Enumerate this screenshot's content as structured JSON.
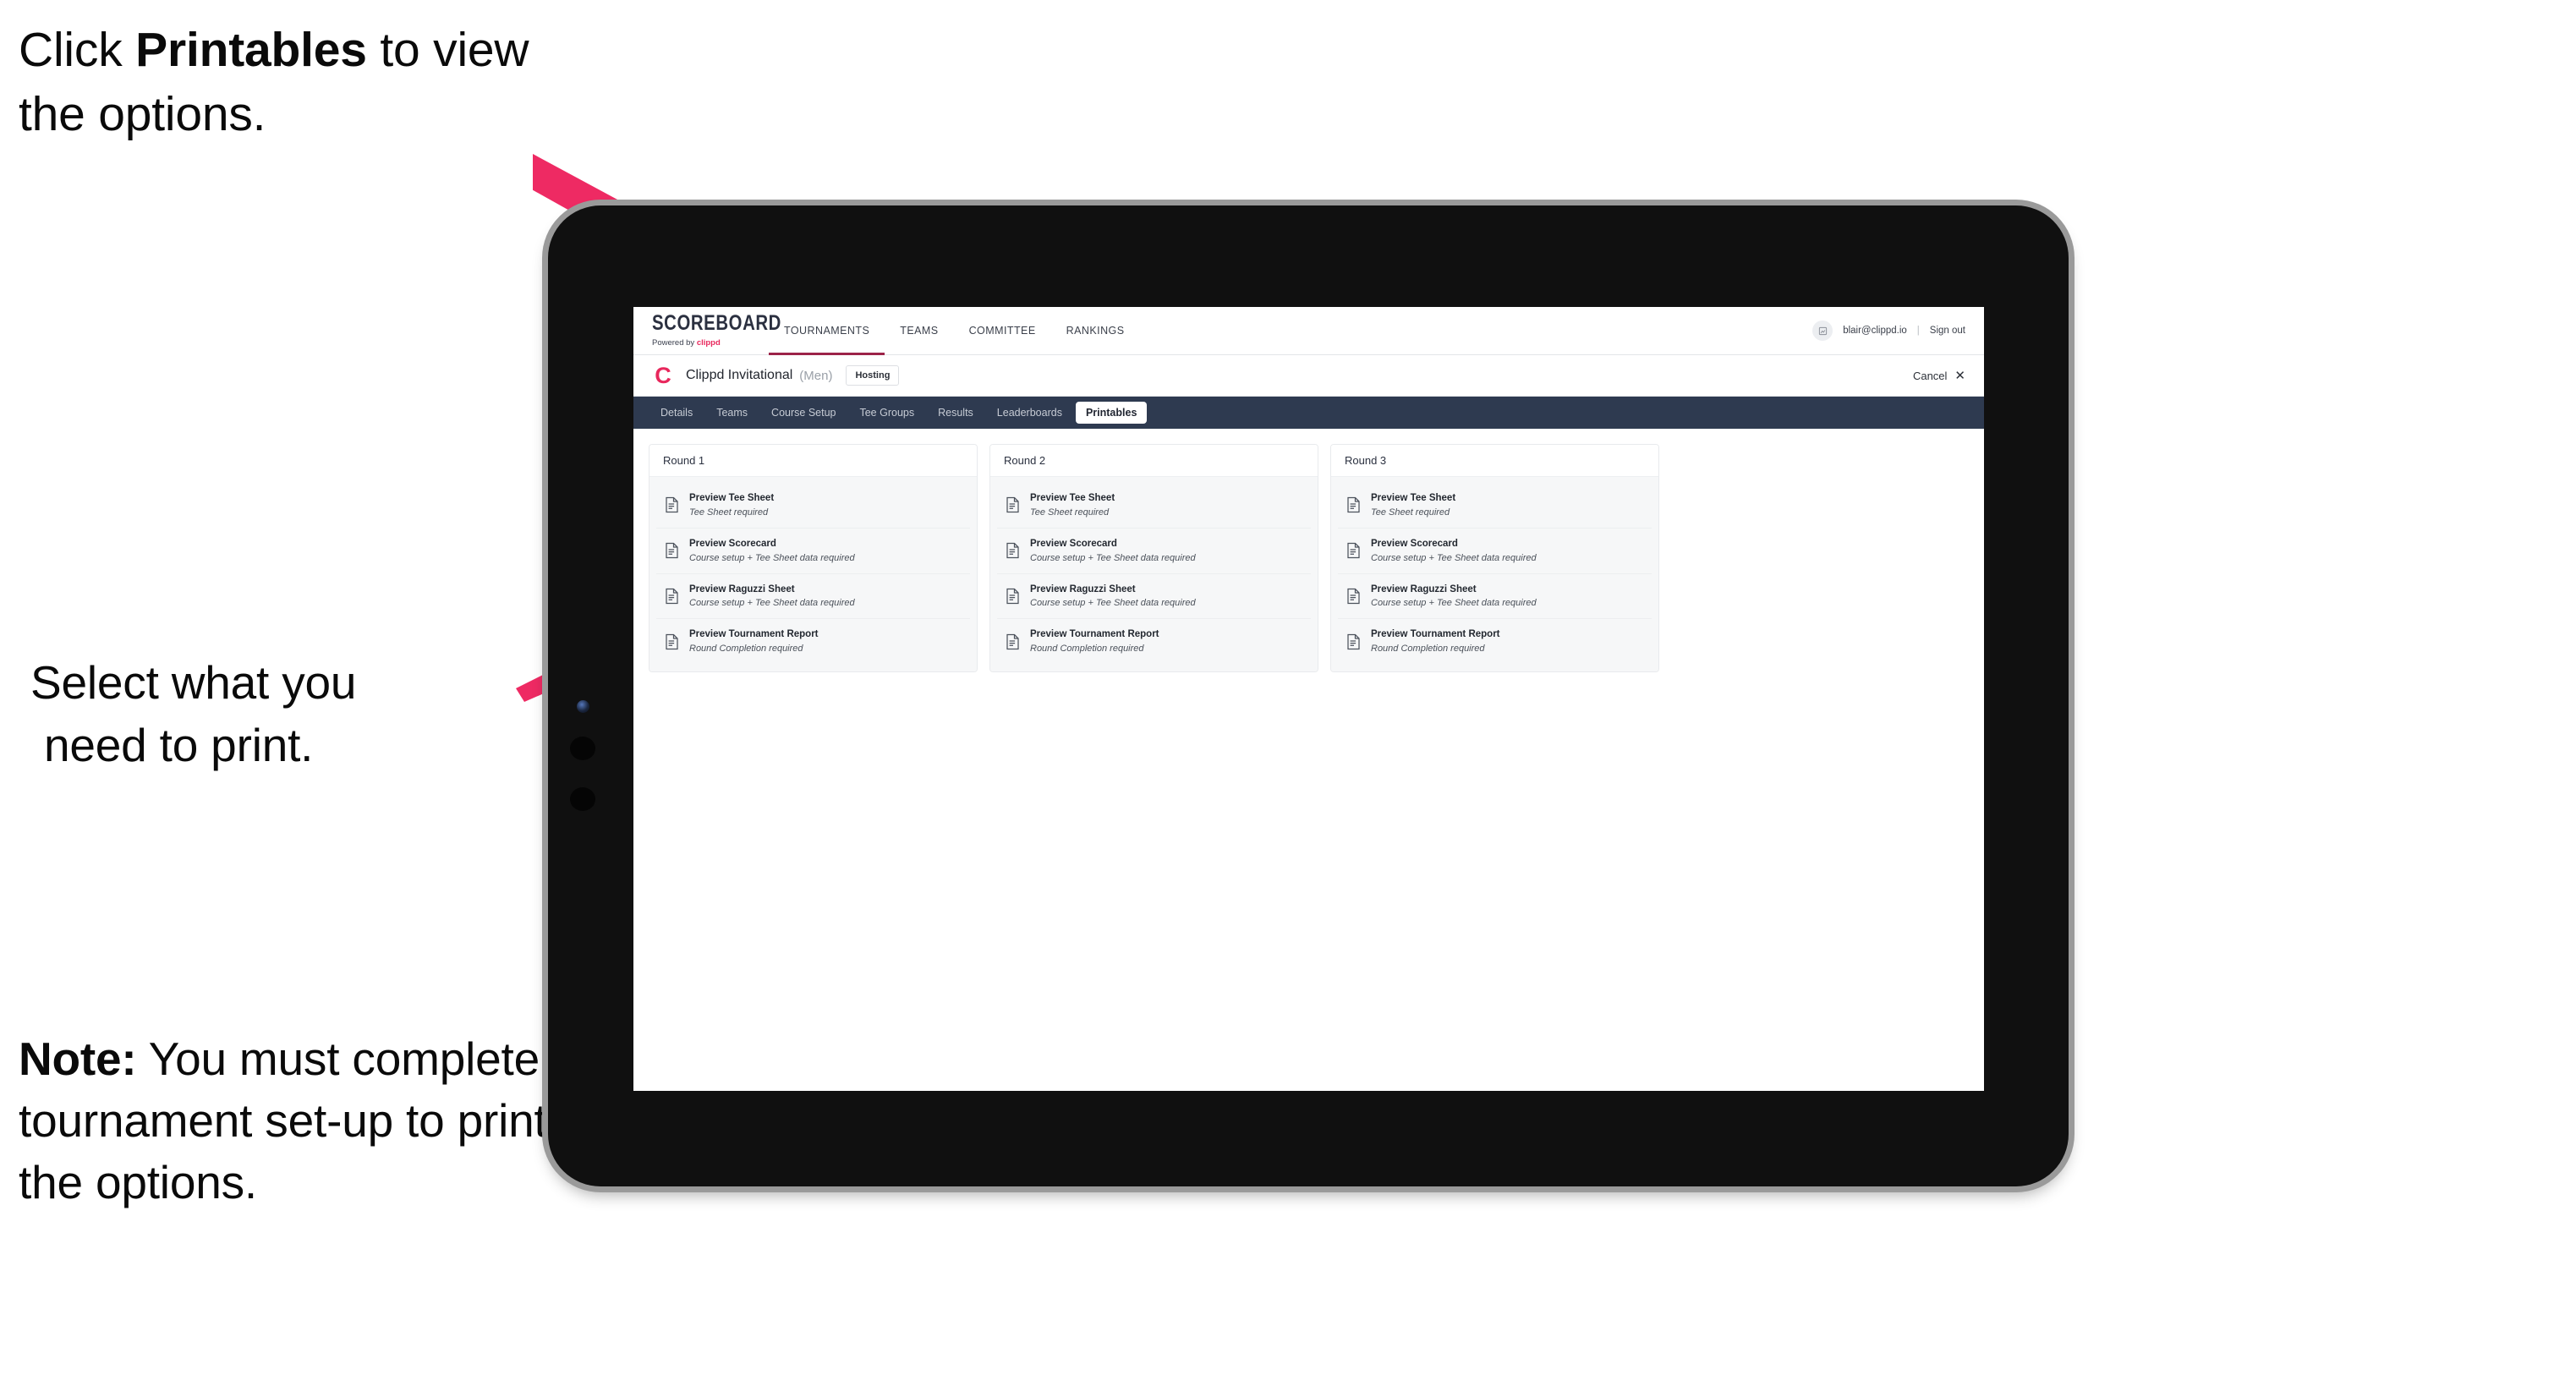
{
  "annotations": {
    "top": {
      "pre": "Click ",
      "bold": "Printables",
      "post": " to view the options."
    },
    "middle": {
      "line1": "Select what you",
      "line2": "need to print."
    },
    "note": {
      "bold": "Note:",
      "rest": " You must complete the tournament set-up to print all the options."
    }
  },
  "colors": {
    "arrow_pink": "#ee2a63",
    "brand_pink": "#e8275c",
    "subnav_dark": "#2e3a50",
    "active_underline": "#9c2348"
  },
  "browser": {
    "topnav": {
      "brand_title": "SCOREBOARD",
      "brand_sub_prefix": "Powered by ",
      "brand_sub_name": "clippd",
      "items": [
        {
          "label": "TOURNAMENTS",
          "active": true
        },
        {
          "label": "TEAMS",
          "active": false
        },
        {
          "label": "COMMITTEE",
          "active": false
        },
        {
          "label": "RANKINGS",
          "active": false
        }
      ],
      "avatar_icon": "user-avatar-icon",
      "user_email": "blair@clippd.io",
      "separator": "|",
      "sign_out": "Sign out"
    },
    "tournament_bar": {
      "logo_letter": "C",
      "name": "Clippd Invitational",
      "gender": "(Men)",
      "badge": "Hosting",
      "cancel_label": "Cancel",
      "cancel_icon": "✕"
    },
    "subnav": {
      "items": [
        {
          "label": "Details",
          "active": false
        },
        {
          "label": "Teams",
          "active": false
        },
        {
          "label": "Course Setup",
          "active": false
        },
        {
          "label": "Tee Groups",
          "active": false
        },
        {
          "label": "Results",
          "active": false
        },
        {
          "label": "Leaderboards",
          "active": false
        },
        {
          "label": "Printables",
          "active": true
        }
      ]
    },
    "rounds": [
      {
        "title": "Round 1",
        "documents": [
          {
            "title": "Preview Tee Sheet",
            "requirement": "Tee Sheet required"
          },
          {
            "title": "Preview Scorecard",
            "requirement": "Course setup + Tee Sheet data required"
          },
          {
            "title": "Preview Raguzzi Sheet",
            "requirement": "Course setup + Tee Sheet data required"
          },
          {
            "title": "Preview Tournament Report",
            "requirement": "Round Completion required"
          }
        ]
      },
      {
        "title": "Round 2",
        "documents": [
          {
            "title": "Preview Tee Sheet",
            "requirement": "Tee Sheet required"
          },
          {
            "title": "Preview Scorecard",
            "requirement": "Course setup + Tee Sheet data required"
          },
          {
            "title": "Preview Raguzzi Sheet",
            "requirement": "Course setup + Tee Sheet data required"
          },
          {
            "title": "Preview Tournament Report",
            "requirement": "Round Completion required"
          }
        ]
      },
      {
        "title": "Round 3",
        "documents": [
          {
            "title": "Preview Tee Sheet",
            "requirement": "Tee Sheet required"
          },
          {
            "title": "Preview Scorecard",
            "requirement": "Course setup + Tee Sheet data required"
          },
          {
            "title": "Preview Raguzzi Sheet",
            "requirement": "Course setup + Tee Sheet data required"
          },
          {
            "title": "Preview Tournament Report",
            "requirement": "Round Completion required"
          }
        ]
      }
    ]
  }
}
